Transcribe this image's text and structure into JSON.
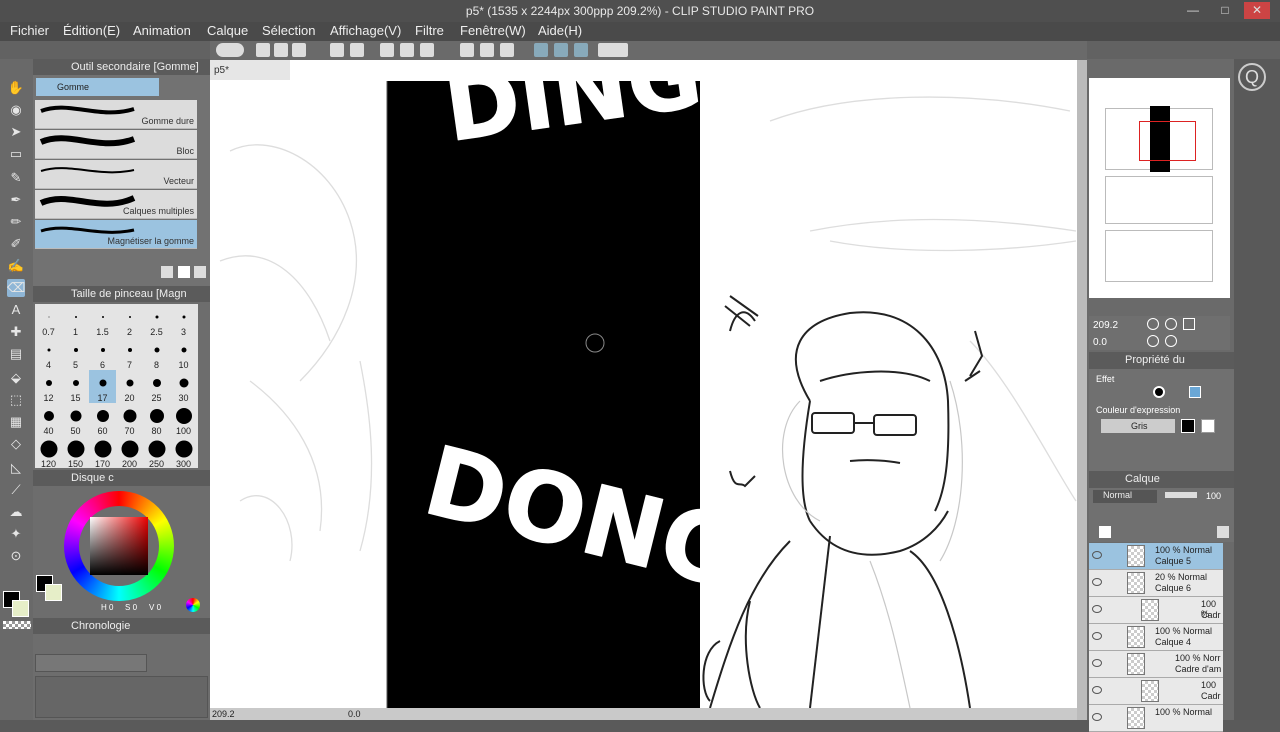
{
  "window": {
    "title": "p5* (1535 x 2244px 300ppp 209.2%)  - CLIP STUDIO PAINT PRO",
    "minimize": "—",
    "maximize": "□",
    "close": "✕"
  },
  "menu": [
    "Fichier",
    "Édition(E)",
    "Animation",
    "Calque",
    "Sélection",
    "Affichage(V)",
    "Filtre",
    "Fenêtre(W)",
    "Aide(H)"
  ],
  "subtool": {
    "header": "Outil secondaire [Gomme]",
    "tab": "Gomme",
    "brushes": [
      "Gomme dure",
      "Bloc",
      "Vecteur",
      "Calques multiples",
      "Magnétiser la gomme"
    ]
  },
  "brushsize": {
    "header": "Taille de pinceau [Magn",
    "sizes": [
      "0.7",
      "1",
      "1.5",
      "2",
      "2.5",
      "3",
      "4",
      "5",
      "6",
      "7",
      "8",
      "10",
      "12",
      "15",
      "17",
      "20",
      "25",
      "30",
      "40",
      "50",
      "60",
      "70",
      "80",
      "100",
      "120",
      "150",
      "170",
      "200",
      "250",
      "300"
    ]
  },
  "color": {
    "header": "Disque c",
    "h": "0",
    "s": "0",
    "v": "0"
  },
  "timeline": {
    "header": "Chronologie"
  },
  "document": {
    "tab": "p5*",
    "zoom": "209.2",
    "angle": "0.0"
  },
  "canvas": {
    "text1": "DING",
    "text2": "DONG"
  },
  "navigator": {
    "zoom": "209.2",
    "angle": "0.0"
  },
  "properties": {
    "header": "Propriété du",
    "effect": "Effet",
    "expression_label": "Couleur d'expression",
    "expression_value": "Gris"
  },
  "layers": {
    "header": "Calque",
    "blend": "Normal",
    "opacity": "100",
    "rows": [
      {
        "l1": "100 % Normal",
        "l2": "Calque 5"
      },
      {
        "l1": "20 % Normal",
        "l2": "Calque 6"
      },
      {
        "l1": "100 %",
        "l2": "Cadr"
      },
      {
        "l1": "100 % Normal",
        "l2": "Calque 4"
      },
      {
        "l1": "100 % Norr",
        "l2": "Cadre d'am"
      },
      {
        "l1": "100",
        "l2": "Cadr"
      },
      {
        "l1": "100 % Normal",
        "l2": ""
      }
    ]
  },
  "colors": {
    "accent": "#6aa7d6",
    "panel": "#6d6d6d",
    "selected": "#9bc3e0"
  }
}
